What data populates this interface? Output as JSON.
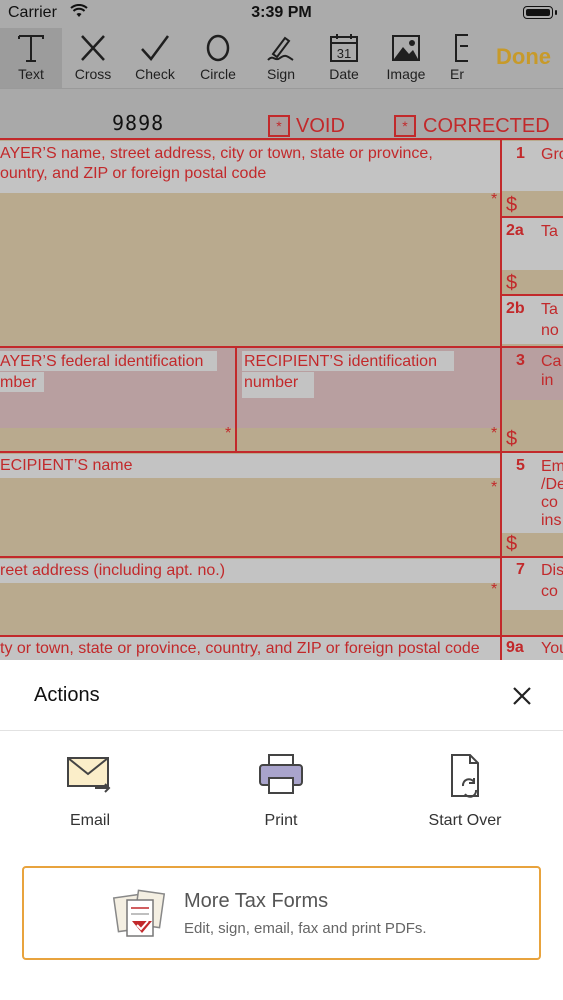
{
  "status_bar": {
    "carrier": "Carrier",
    "time": "3:39 PM"
  },
  "toolbar": {
    "tools": [
      {
        "label": "Text"
      },
      {
        "label": "Cross"
      },
      {
        "label": "Check"
      },
      {
        "label": "Circle"
      },
      {
        "label": "Sign"
      },
      {
        "label": "Date",
        "date_day": "31"
      },
      {
        "label": "Image"
      },
      {
        "label": "Er"
      }
    ],
    "done_label": "Done"
  },
  "form": {
    "form_number": "9898",
    "void_label": "VOID",
    "corrected_label": "CORRECTED",
    "checkbox_mark": "*",
    "payer_name_label_1": "AYER’S name, street address, city or town, state or province,",
    "payer_name_label_2": "ountry, and ZIP or foreign postal code",
    "payer_tin_label_1": "AYER’S federal identification",
    "payer_tin_label_2": "mber",
    "recipient_tin_label_1": "RECIPIENT’S identification",
    "recipient_tin_label_2": "number",
    "recipient_name_label": "ECIPIENT’S name",
    "street_label": "reet address (including apt. no.)",
    "city_label": "ty or town, state or province, country, and ZIP or foreign postal code",
    "boxes": [
      {
        "num": "1",
        "text": "Gro"
      },
      {
        "num": "2a",
        "text": "Ta"
      },
      {
        "num": "2b",
        "text": "Ta",
        "text2": "no"
      },
      {
        "num": "3",
        "text": "Ca",
        "text2": "in"
      },
      {
        "num": "5",
        "text": "Em",
        "text2": "/De",
        "text3": "co",
        "text4": "ins"
      },
      {
        "num": "7",
        "text": "Dis",
        "text2": "co"
      },
      {
        "num": "9a",
        "text": "You"
      }
    ],
    "dollar": "$",
    "required_mark": "*"
  },
  "actions": {
    "title": "Actions",
    "items": [
      {
        "label": "Email",
        "icon": "email-icon"
      },
      {
        "label": "Print",
        "icon": "printer-icon"
      },
      {
        "label": "Start Over",
        "icon": "start-over-icon"
      }
    ],
    "promo": {
      "title": "More Tax Forms",
      "subtitle": "Edit, sign, email, fax and print PDFs."
    }
  },
  "colors": {
    "form_red": "#c2292b",
    "done_gold": "#c79a2a",
    "promo_border": "#e8a33d"
  }
}
